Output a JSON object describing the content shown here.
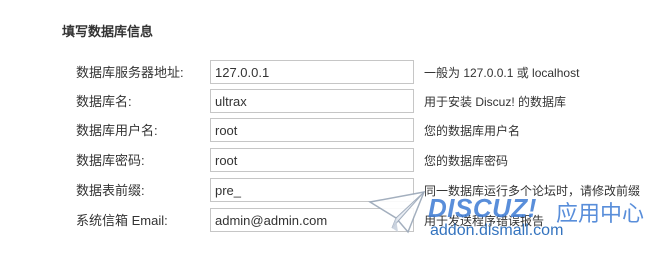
{
  "section": {
    "title": "填写数据库信息"
  },
  "fields": [
    {
      "label": "数据库服务器地址:",
      "value": "127.0.0.1",
      "hint": "一般为 127.0.0.1 或 localhost"
    },
    {
      "label": "数据库名:",
      "value": "ultrax",
      "hint": "用于安装 Discuz! 的数据库"
    },
    {
      "label": "数据库用户名:",
      "value": "root",
      "hint": "您的数据库用户名"
    },
    {
      "label": "数据库密码:",
      "value": "root",
      "hint": "您的数据库密码"
    },
    {
      "label": "数据表前缀:",
      "value": "pre_",
      "hint": "同一数据库运行多个论坛时，请修改前缀"
    },
    {
      "label": "系统信箱 Email:",
      "value": "admin@admin.com",
      "hint": "用于发送程序错误报告"
    }
  ],
  "watermark": {
    "brand": "DISCUZ!",
    "subtitle": "应用中心",
    "url": "addon.dismall.com"
  },
  "colors": {
    "input_border": "#c6c6c6",
    "text": "#333333",
    "watermark_blue": "#3d7bd4"
  }
}
